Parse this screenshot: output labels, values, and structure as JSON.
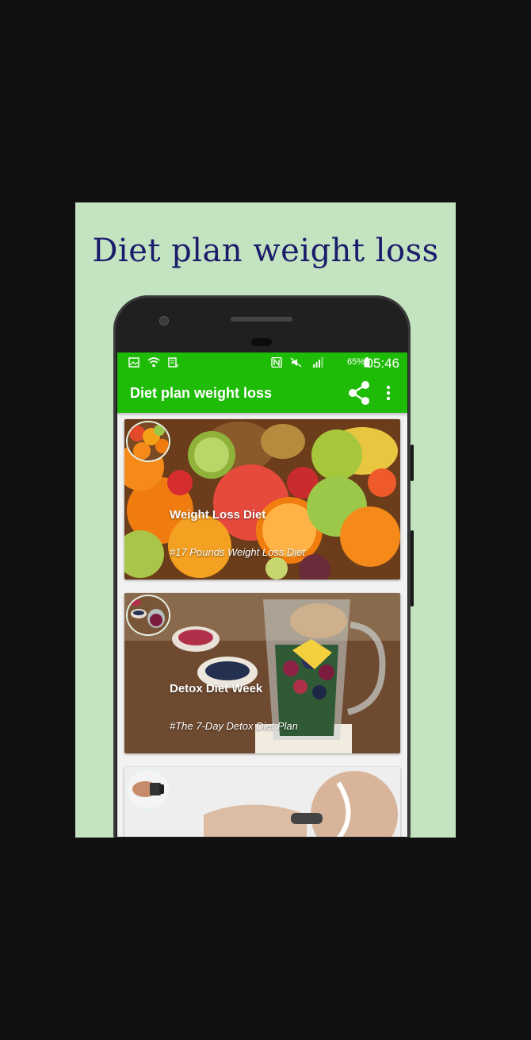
{
  "promo": {
    "title": "Diet plan weight loss"
  },
  "status_bar": {
    "battery": "65%",
    "time": "05:46",
    "left_icons": [
      "image-icon",
      "wifi-icon",
      "sim-icon"
    ],
    "right_icons": [
      "nfc-icon",
      "mute-icon",
      "signal-icon",
      "battery-icon"
    ]
  },
  "app_bar": {
    "title": "Diet plan weight loss",
    "actions": [
      "share-icon",
      "overflow-menu-icon"
    ]
  },
  "cards": [
    {
      "title": "Weight Loss Diet",
      "subtitle": "#17 Pounds Weight Loss Diet"
    },
    {
      "title": "Detox Diet Week",
      "subtitle": "#The 7-Day Detox Diet Plan"
    },
    {
      "title": "",
      "subtitle": ""
    }
  ],
  "nav_bar": {
    "buttons": [
      "back-icon",
      "home-icon",
      "recents-icon"
    ]
  },
  "colors": {
    "promo_background": "#c4e3c1",
    "accent_green": "#1fbc07",
    "promo_title": "#1b1b6b"
  }
}
